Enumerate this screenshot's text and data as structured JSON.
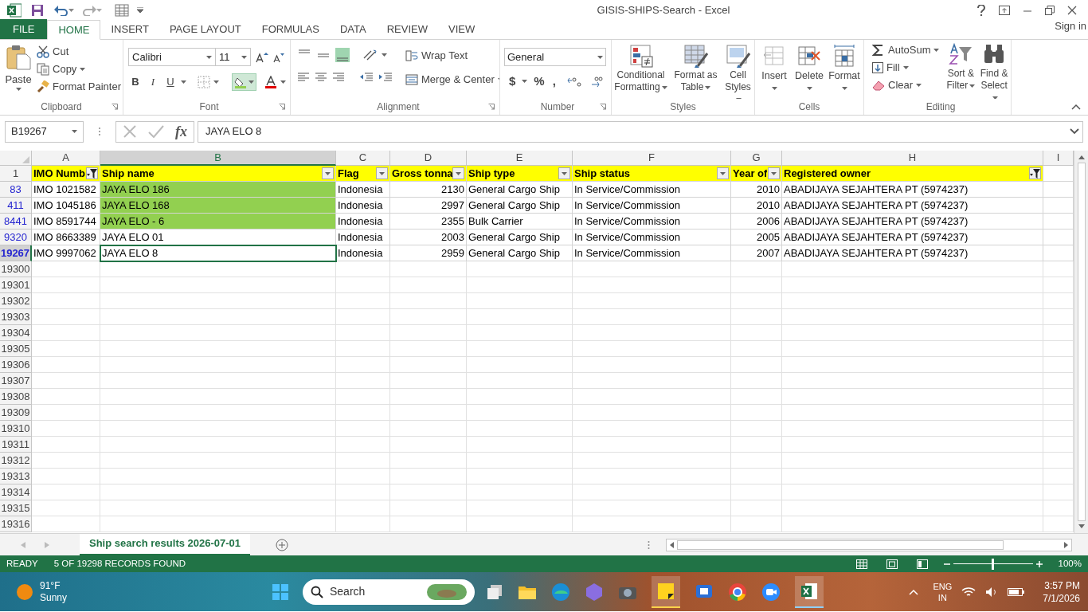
{
  "title_bar": {
    "title": "GISIS-SHIPS-Search - Excel",
    "sign_in": "Sign in"
  },
  "ribbon_tabs": [
    {
      "label": "FILE",
      "kind": "file",
      "selected": false
    },
    {
      "label": "HOME",
      "kind": "tab",
      "selected": true
    },
    {
      "label": "INSERT",
      "kind": "tab",
      "selected": false
    },
    {
      "label": "PAGE LAYOUT",
      "kind": "tab",
      "selected": false
    },
    {
      "label": "FORMULAS",
      "kind": "tab",
      "selected": false
    },
    {
      "label": "DATA",
      "kind": "tab",
      "selected": false
    },
    {
      "label": "REVIEW",
      "kind": "tab",
      "selected": false
    },
    {
      "label": "VIEW",
      "kind": "tab",
      "selected": false
    }
  ],
  "clipboard": {
    "label": "Clipboard",
    "paste": "Paste",
    "cut": "Cut",
    "copy": "Copy",
    "format_painter": "Format Painter"
  },
  "font": {
    "label": "Font",
    "font_name": "Calibri",
    "font_size": "11",
    "style_buttons": [
      "B",
      "I",
      "U"
    ]
  },
  "alignment": {
    "label": "Alignment",
    "wrap_text": "Wrap Text",
    "merge_center": "Merge & Center"
  },
  "number": {
    "label": "Number",
    "format": "General",
    "symbols": [
      "$",
      "%",
      ","
    ]
  },
  "styles": {
    "label": "Styles",
    "buttons": [
      "Conditional Formatting",
      "Format as Table",
      "Cell Styles"
    ]
  },
  "cells": {
    "label": "Cells",
    "buttons": [
      "Insert",
      "Delete",
      "Format"
    ]
  },
  "editing": {
    "label": "Editing",
    "autosum": "AutoSum",
    "fill": "Fill",
    "clear": "Clear",
    "sort_filter": "Sort & Filter",
    "find_select": "Find & Select"
  },
  "formula_bar": {
    "name_box": "B19267",
    "function_label": "fx",
    "formula": "JAYA ELO 8"
  },
  "sheet": {
    "columns": [
      {
        "letter": "A",
        "header": "IMO Numb",
        "kind": "text",
        "filtered": true,
        "selected": false
      },
      {
        "letter": "B",
        "header": "Ship name",
        "kind": "text",
        "filtered": false,
        "selected": true
      },
      {
        "letter": "C",
        "header": "Flag",
        "kind": "text",
        "filtered": false,
        "selected": false
      },
      {
        "letter": "D",
        "header": "Gross tonna",
        "kind": "number",
        "filtered": false,
        "selected": false
      },
      {
        "letter": "E",
        "header": "Ship type",
        "kind": "text",
        "filtered": false,
        "selected": false
      },
      {
        "letter": "F",
        "header": "Ship status",
        "kind": "text",
        "filtered": false,
        "selected": false
      },
      {
        "letter": "G",
        "header": "Year of",
        "kind": "number",
        "filtered": false,
        "selected": false
      },
      {
        "letter": "H",
        "header": "Registered owner",
        "kind": "text",
        "filtered": true,
        "selected": false
      },
      {
        "letter": "I",
        "kind": "text",
        "selected": false
      }
    ],
    "header_row": "1",
    "rows": [
      {
        "number": "83",
        "selected": false,
        "highlighted": true,
        "cells": [
          "IMO 1021582",
          "JAYA ELO 186",
          "Indonesia",
          "2130",
          "General Cargo Ship",
          "In Service/Commission",
          "2010",
          "ABADIJAYA SEJAHTERA PT (5974237)"
        ]
      },
      {
        "number": "411",
        "selected": false,
        "highlighted": true,
        "cells": [
          "IMO 1045186",
          "JAYA ELO 168",
          "Indonesia",
          "2997",
          "General Cargo Ship",
          "In Service/Commission",
          "2010",
          "ABADIJAYA SEJAHTERA PT (5974237)"
        ]
      },
      {
        "number": "8441",
        "selected": false,
        "highlighted": true,
        "cells": [
          "IMO 8591744",
          "JAYA ELO - 6",
          "Indonesia",
          "2355",
          "Bulk Carrier",
          "In Service/Commission",
          "2006",
          "ABADIJAYA SEJAHTERA PT (5974237)"
        ]
      },
      {
        "number": "9320",
        "selected": false,
        "highlighted": false,
        "cells": [
          "IMO 8663389",
          "JAYA ELO 01",
          "Indonesia",
          "2003",
          "General Cargo Ship",
          "In Service/Commission",
          "2005",
          "ABADIJAYA SEJAHTERA PT (5974237)"
        ]
      },
      {
        "number": "19267",
        "selected": true,
        "highlighted": false,
        "cells": [
          "IMO 9997062",
          "JAYA ELO 8",
          "Indonesia",
          "2959",
          "General Cargo Ship",
          "In Service/Commission",
          "2007",
          "ABADIJAYA SEJAHTERA PT (5974237)"
        ]
      }
    ],
    "empty_rows": [
      "19300",
      "19301",
      "19302",
      "19303",
      "19304",
      "19305",
      "19306",
      "19307",
      "19308",
      "19309",
      "19310",
      "19311",
      "19312",
      "19313",
      "19314",
      "19315",
      "19316"
    ]
  },
  "sheet_tabs": [
    {
      "label": "Ship search results 2026-07-01",
      "selected": true
    }
  ],
  "status_bar": {
    "mode": "READY",
    "message": "5 OF 19298 RECORDS FOUND",
    "zoom": "100%",
    "zoom_level": {
      "level": 0.5
    }
  },
  "taskbar": {
    "temperature": "91°F",
    "weather": "Sunny",
    "search": "Search",
    "language": "ENG",
    "region": "IN",
    "time": "3:57 PM",
    "date": "7/1/2026"
  }
}
